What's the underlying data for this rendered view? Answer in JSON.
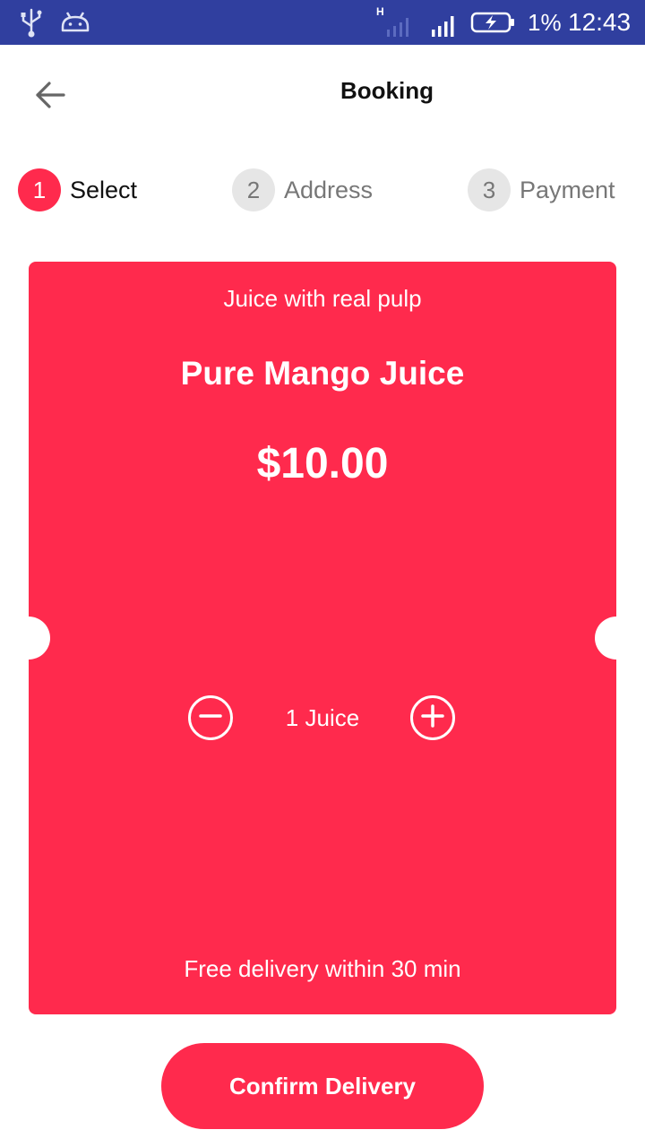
{
  "status_bar": {
    "battery_percent": "1%",
    "time": "12:43",
    "network_label": "H",
    "icons": [
      "usb-icon",
      "android-debug-icon",
      "signal-h-icon",
      "signal-icon",
      "battery-charging-icon"
    ]
  },
  "header": {
    "title": "Booking",
    "back_icon": "arrow-left-icon"
  },
  "stepper": {
    "steps": [
      {
        "number": "1",
        "label": "Select",
        "active": true
      },
      {
        "number": "2",
        "label": "Address",
        "active": false
      },
      {
        "number": "3",
        "label": "Payment",
        "active": false
      }
    ]
  },
  "card": {
    "subtitle": "Juice with real pulp",
    "title": "Pure Mango Juice",
    "price": "$10.00",
    "quantity_label": "1 Juice",
    "minus_icon": "minus-circle-icon",
    "plus_icon": "plus-circle-icon",
    "footer": "Free delivery within 30 min"
  },
  "actions": {
    "confirm_label": "Confirm Delivery"
  },
  "colors": {
    "accent": "#ff2a4d",
    "status_bar": "#303f9f",
    "inactive_step": "#e6e6e6"
  }
}
